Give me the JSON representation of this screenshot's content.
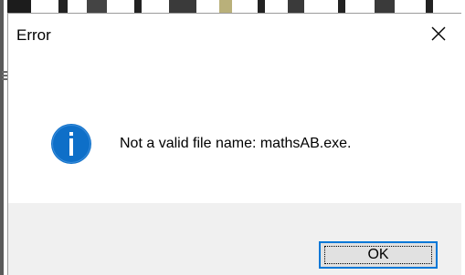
{
  "dialog": {
    "title": "Error",
    "close_icon": "close-icon",
    "message_icon": "info-icon",
    "message": "Not a valid file name: mathsAB.exe.",
    "ok_label": "OK"
  },
  "colors": {
    "info_icon_fill": "#0e6fc8",
    "button_border": "#0078d7",
    "footer_bg": "#f0f0f0"
  }
}
